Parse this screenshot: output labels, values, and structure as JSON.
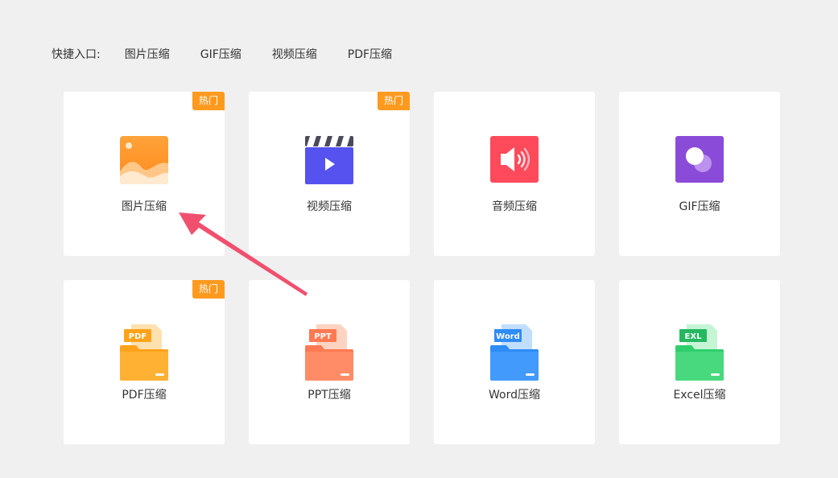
{
  "quick_access": {
    "label": "快捷入口:",
    "links": [
      "图片压缩",
      "GIF压缩",
      "视频压缩",
      "PDF压缩"
    ]
  },
  "hot_badge": "热门",
  "tools": [
    {
      "title": "图片压缩",
      "hot": true,
      "icon": "image-icon",
      "color": "#ff9a2e"
    },
    {
      "title": "视频压缩",
      "hot": true,
      "icon": "video-icon",
      "color": "#5552f0"
    },
    {
      "title": "音频压缩",
      "hot": false,
      "icon": "audio-icon",
      "color": "#ff4a5c"
    },
    {
      "title": "GIF压缩",
      "hot": false,
      "icon": "gif-icon",
      "color": "#8b4bd9"
    },
    {
      "title": "PDF压缩",
      "hot": true,
      "icon": "pdf-folder-icon",
      "tag": "PDF",
      "color": "#ffa31a"
    },
    {
      "title": "PPT压缩",
      "hot": false,
      "icon": "ppt-folder-icon",
      "tag": "PPT",
      "color": "#ff7a52"
    },
    {
      "title": "Word压缩",
      "hot": false,
      "icon": "word-folder-icon",
      "tag": "Word",
      "color": "#2e8cf5"
    },
    {
      "title": "Excel压缩",
      "hot": false,
      "icon": "excel-folder-icon",
      "tag": "EXL",
      "color": "#2fcf6b"
    }
  ],
  "colors": {
    "arrow": "#f0506e",
    "badge": "#ff9a1f",
    "background": "#f0f0f0"
  }
}
